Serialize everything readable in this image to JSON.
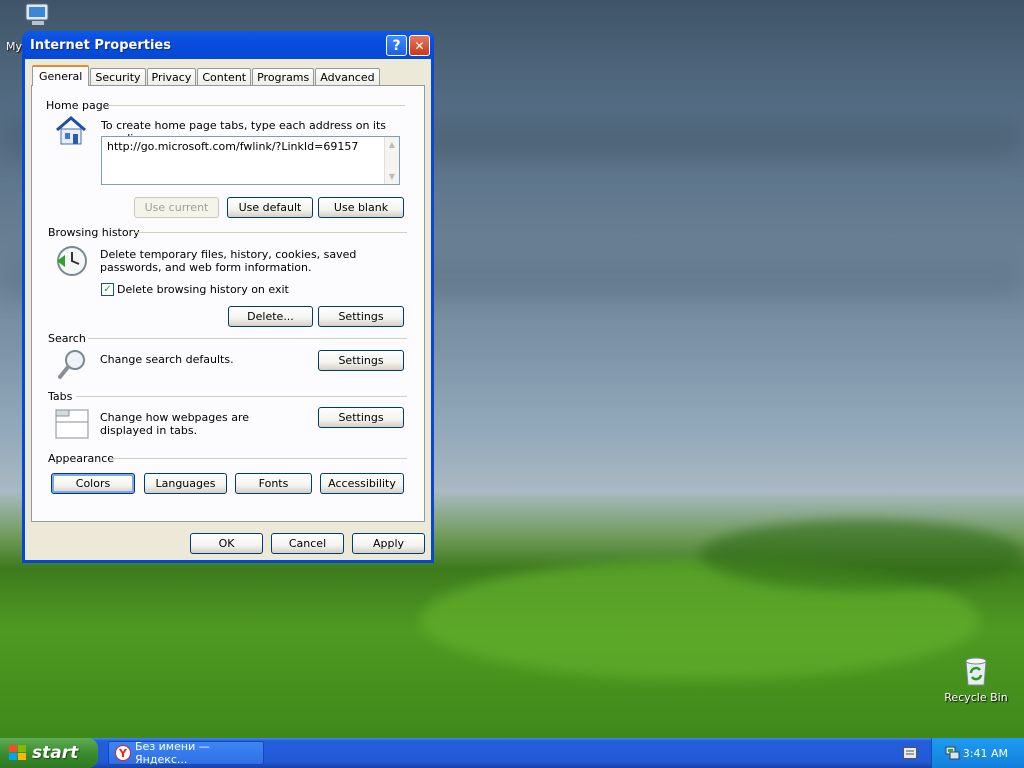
{
  "desktop": {
    "my_computer_label": "My",
    "recycle_bin_label": "Recycle Bin"
  },
  "window": {
    "title": "Internet Properties",
    "help_glyph": "?",
    "close_glyph": "✕",
    "tabs": [
      "General",
      "Security",
      "Privacy",
      "Content",
      "Programs",
      "Advanced"
    ],
    "active_tab": "General",
    "home_page": {
      "title": "Home page",
      "description": "To create home page tabs, type each address on its own line.",
      "url": "http://go.microsoft.com/fwlink/?LinkId=69157",
      "use_current": "Use current",
      "use_default": "Use default",
      "use_blank": "Use blank"
    },
    "browsing_history": {
      "title": "Browsing history",
      "description": "Delete temporary files, history, cookies, saved passwords, and web form information.",
      "checkbox_label": "Delete browsing history on exit",
      "checkbox_checked": true,
      "delete_button": "Delete...",
      "settings_button": "Settings"
    },
    "search": {
      "title": "Search",
      "description": "Change search defaults.",
      "settings_button": "Settings"
    },
    "tabs_section": {
      "title": "Tabs",
      "description": "Change how webpages are displayed in tabs.",
      "settings_button": "Settings"
    },
    "appearance": {
      "title": "Appearance",
      "colors": "Colors",
      "languages": "Languages",
      "fonts": "Fonts",
      "accessibility": "Accessibility"
    },
    "footer": {
      "ok": "OK",
      "cancel": "Cancel",
      "apply": "Apply"
    }
  },
  "taskbar": {
    "start_label": "start",
    "task_label": "Без имени — Яндекс...",
    "clock": "3:41 AM"
  },
  "colors": {
    "title_bar": "#0449d8",
    "dialog_bg": "#ece9d8",
    "taskbar": "#245edb",
    "start_button": "#3c8d2f",
    "tab_highlight": "#e68b2c"
  }
}
